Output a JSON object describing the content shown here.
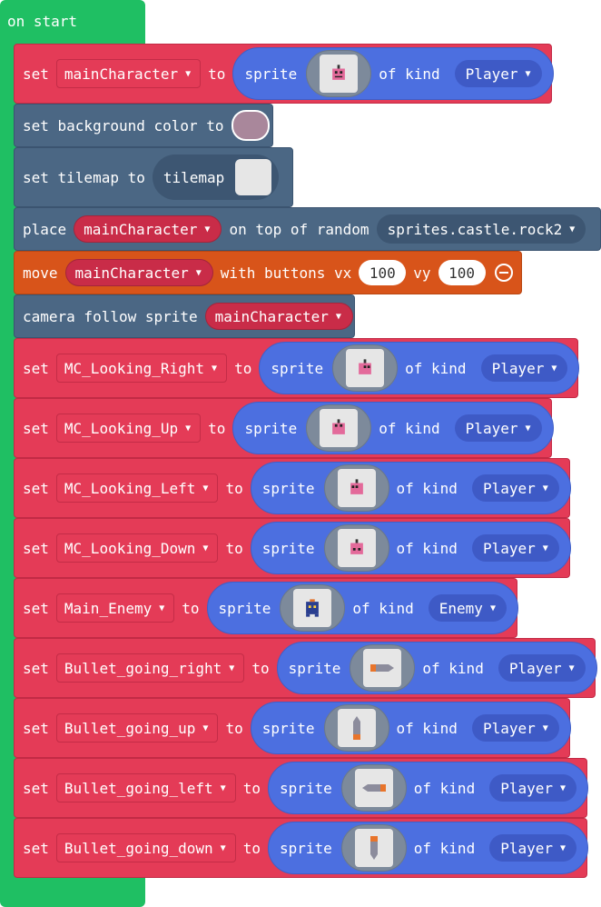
{
  "hat": {
    "label": "on start"
  },
  "blocks": {
    "set_main": {
      "set": "set",
      "var": "mainCharacter",
      "to": "to",
      "sprite": "sprite",
      "of_kind": "of kind",
      "kind": "Player",
      "image": "robot-icon"
    },
    "bg": {
      "label": "set background color to",
      "color": "#a9879b"
    },
    "tilemap": {
      "label": "set tilemap to",
      "arg": "tilemap"
    },
    "place": {
      "place": "place",
      "var": "mainCharacter",
      "mid": "on top of random",
      "tile": "sprites.castle.rock2"
    },
    "move": {
      "move": "move",
      "var": "mainCharacter",
      "mid": "with buttons vx",
      "vx": "100",
      "vy_label": "vy",
      "vy": "100"
    },
    "camera": {
      "label": "camera follow sprite",
      "var": "mainCharacter"
    },
    "mc_right": {
      "set": "set",
      "var": "MC_Looking_Right",
      "to": "to",
      "sprite": "sprite",
      "of_kind": "of kind",
      "kind": "Player"
    },
    "mc_up": {
      "set": "set",
      "var": "MC_Looking_Up",
      "to": "to",
      "sprite": "sprite",
      "of_kind": "of kind",
      "kind": "Player"
    },
    "mc_left": {
      "set": "set",
      "var": "MC_Looking_Left",
      "to": "to",
      "sprite": "sprite",
      "of_kind": "of kind",
      "kind": "Player"
    },
    "mc_down": {
      "set": "set",
      "var": "MC_Looking_Down",
      "to": "to",
      "sprite": "sprite",
      "of_kind": "of kind",
      "kind": "Player"
    },
    "enemy": {
      "set": "set",
      "var": "Main_Enemy",
      "to": "to",
      "sprite": "sprite",
      "of_kind": "of kind",
      "kind": "Enemy"
    },
    "b_right": {
      "set": "set",
      "var": "Bullet_going_right",
      "to": "to",
      "sprite": "sprite",
      "of_kind": "of kind",
      "kind": "Player"
    },
    "b_up": {
      "set": "set",
      "var": "Bullet_going_up",
      "to": "to",
      "sprite": "sprite",
      "of_kind": "of kind",
      "kind": "Player"
    },
    "b_left": {
      "set": "set",
      "var": "Bullet_going_left",
      "to": "to",
      "sprite": "sprite",
      "of_kind": "of kind",
      "kind": "Player"
    },
    "b_down": {
      "set": "set",
      "var": "Bullet_going_down",
      "to": "to",
      "sprite": "sprite",
      "of_kind": "of kind",
      "kind": "Player"
    }
  },
  "colors": {
    "event": "#1fbf63",
    "variables": "#e43b57",
    "scene": "#4b6784",
    "controller": "#d8541a",
    "sprites": "#4c6fe0"
  }
}
